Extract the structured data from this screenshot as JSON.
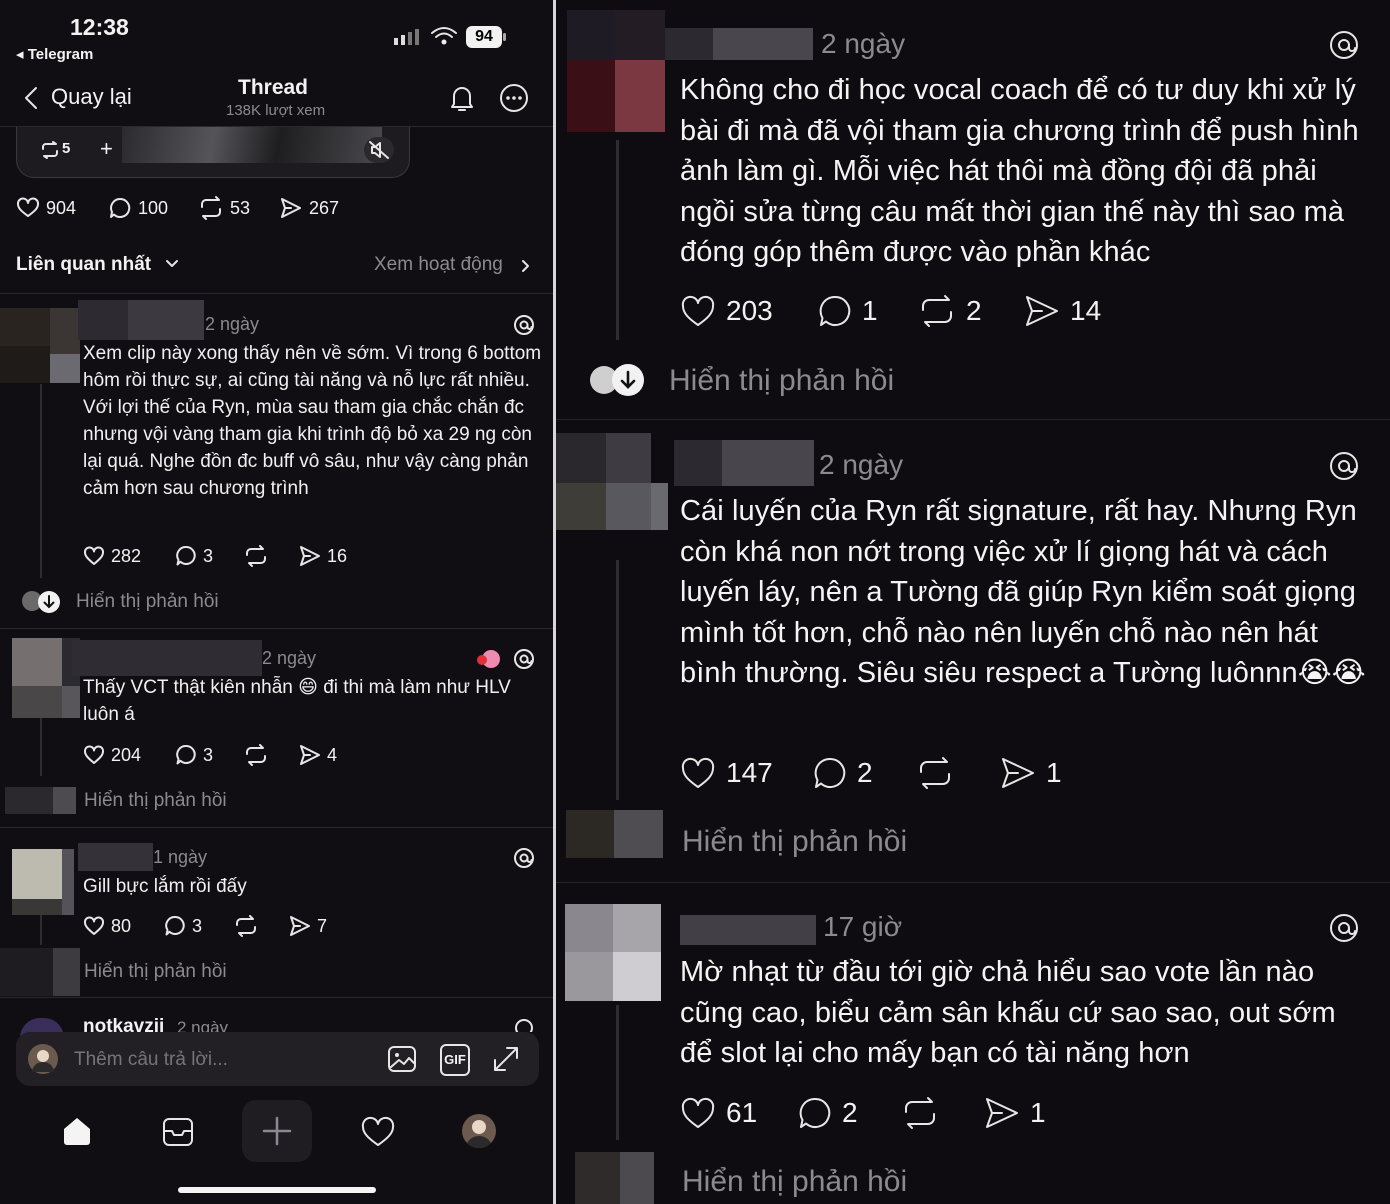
{
  "status_bar": {
    "time": "12:38",
    "back_app": "◂ Telegram",
    "battery": "94"
  },
  "header": {
    "back_label": "Quay lại",
    "title": "Thread",
    "views": "138K lượt xem"
  },
  "media_card": {
    "repost_count": "5",
    "add_symbol": "+"
  },
  "post_stats": {
    "likes": "904",
    "comments": "100",
    "reposts": "53",
    "shares": "267"
  },
  "sort": {
    "label": "Liên quan nhất",
    "activity_link": "Xem hoạt động"
  },
  "left_comments": [
    {
      "time": "2 ngày",
      "text": "Xem clip này xong thấy nên về sớm. Vì trong 6 bottom hôm rồi thực sự, ai cũng tài năng và nỗ lực rất nhiều. Với lợi thế của Ryn, mùa sau tham gia chắc chắn đc nhưng vội vàng tham gia khi trình độ bỏ xa 29 ng còn lại quá. Nghe đồn đc buff vô sâu, như vậy càng phản cảm hơn sau chương trình",
      "likes": "282",
      "comments": "3",
      "reposts": "",
      "shares": "16",
      "show_replies": "Hiển thị phản hồi"
    },
    {
      "time": "2 ngày",
      "text": "Thấy VCT thật kiên nhẫn 😄 đi thi mà làm như HLV luôn á",
      "likes": "204",
      "comments": "3",
      "reposts": "",
      "shares": "4",
      "show_replies": "Hiển thị phản hồi"
    },
    {
      "time": "1 ngày",
      "text": "Gill bực lắm rồi đấy",
      "likes": "80",
      "comments": "3",
      "reposts": "",
      "shares": "7",
      "show_replies": "Hiển thị phản hồi"
    }
  ],
  "partial_comment": {
    "username": "notkavzii",
    "time": "2 ngày"
  },
  "reply_bar": {
    "placeholder": "Thêm câu trả lời...",
    "gif_label": "GIF"
  },
  "right_comments": [
    {
      "time": "2 ngày",
      "text": "Không cho đi học vocal coach để có tư duy khi xử lý bài đi mà đã vội tham gia chương trình để push hình ảnh làm gì. Mỗi việc hát thôi mà đồng đội đã phải ngồi sửa từng câu mất thời gian thế này thì sao mà đóng góp thêm được vào phần khác",
      "likes": "203",
      "comments": "1",
      "reposts": "2",
      "shares": "14",
      "show_replies": "Hiển thị phản hồi"
    },
    {
      "time": "2 ngày",
      "text": "Cái luyến của Ryn rất signature, rất hay. Nhưng Ryn còn khá non nớt trong việc xử lí giọng hát và cách luyến láy, nên a Tường đã giúp Ryn kiểm soát giọng mình tốt hơn, chỗ nào nên luyến chỗ nào nên hát bình thường. Siêu siêu respect a Tường luônnn😭😭",
      "likes": "147",
      "comments": "2",
      "reposts": "",
      "shares": "1",
      "show_replies": "Hiển thị phản hồi"
    },
    {
      "time": "17 giờ",
      "text": "Mờ nhạt từ đầu tới giờ chả hiểu sao vote lần nào cũng cao, biểu cảm sân khấu cứ sao sao, out sớm để slot lại cho mấy bạn có tài năng hơn",
      "likes": "61",
      "comments": "2",
      "reposts": "",
      "shares": "1",
      "show_replies": "Hiển thị phản hồi"
    }
  ]
}
